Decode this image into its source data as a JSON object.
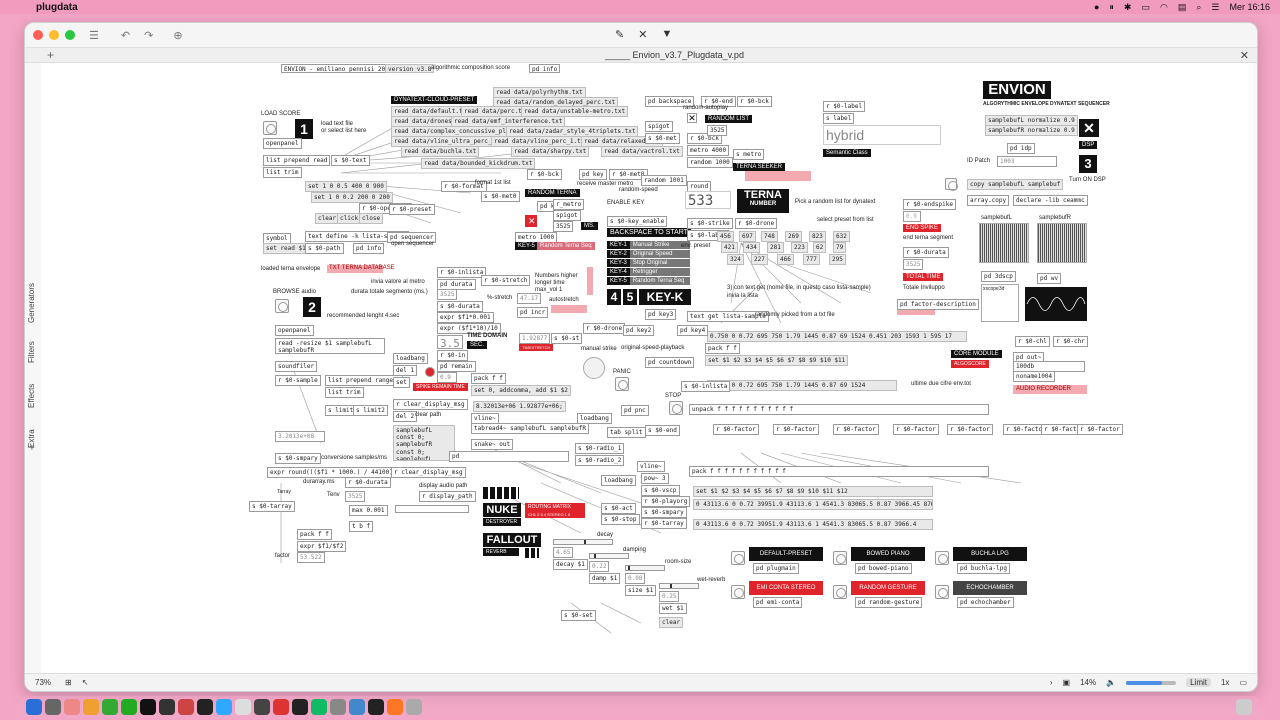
{
  "menubar": {
    "app": "plugdata",
    "clock": "Mer 16:16"
  },
  "window": {
    "tab_title": "_____ Envion_v3.7_Plugdata_v.pd",
    "side_tabs": [
      "Generators",
      "Filters",
      "Effects",
      "Extra"
    ],
    "side_plus": "+"
  },
  "patch": {
    "header": [
      "ENVION - emiliano pennisi 2025",
      "version v3.8",
      "algorithmic composition score",
      "pd info"
    ],
    "load_score": "LOAD SCORE",
    "load_text": "load text file",
    "or_select": "or select list here",
    "openpanel": "openpanel",
    "list_prepend_read": "list prepend read",
    "list_trim": "list trim",
    "num1": "1",
    "num2": "2",
    "num3": "3",
    "send_text": "s $0-text",
    "dynatext_preset": "DYNATEXT-CLOUD-PRESET",
    "read_files": [
      "read data/polyrhythm.txt",
      "read data/random_delayed_perc.txt",
      "read data/default.txt",
      "read data/perc.txt",
      "read data/unstable-metro.txt",
      "read data/drones.txt",
      "read data/emf_interference.txt",
      "read data/complex_concussive_plain.txt",
      "read data/zadar_style_4triplets.txt",
      "read data/vline_ultra_perc_3.txt",
      "read data/vline_perc_1.txt",
      "read data/relaxed.txt",
      "read data/buchla.txt",
      "read data/sharpy.txt",
      "read data/vactrol.txt",
      "read data/bounded_kickdrum.txt"
    ],
    "set_lists": [
      "set 1 0 0.5 400 0 900",
      "set 1 0 0.2 200 0 200"
    ],
    "clear": "clear",
    "click": "click",
    "close": "close",
    "r_openlist": "r $0-openlist",
    "r_preset": "r $0-preset",
    "symbol": "symbol",
    "set_read": "set read $1",
    "text_define": "text define -k lista-sample",
    "s_path": "s $0-path",
    "pd_info2": "pd info",
    "pd_sequencer": "pd sequencer",
    "open_sequencer": "open sequencer",
    "loaded_envelope": "loaded terna envelope",
    "txt_db": "TXT TERNA DATABASE",
    "format_1st": "format 1st list",
    "r_format": "r $0-format",
    "s_met0": "s $0-met0",
    "r_bck": "r $0-bck",
    "random_terna": "RANDOM TERNA",
    "receive_master": "receive master metro",
    "random_speed": "random-speed",
    "pd_key": "pd key",
    "r_met0": "r $0-met0",
    "r_metro": "r_metro",
    "spigot": "spigot",
    "metro1000": "metro 1000",
    "ms": "MS.",
    "key5": "KEY-5",
    "random_terna_seq": "Random Terna Seq",
    "enable_key": "ENABLE KEY",
    "s_key_enable": "s $0-key_enable",
    "backspace_start": "BACKSPACE TO START",
    "keys": [
      {
        "k": "KEY-1",
        "v": "Manual Strike"
      },
      {
        "k": "KEY-2",
        "v": "Original Speed"
      },
      {
        "k": "KEY-3",
        "v": "Stop Original"
      },
      {
        "k": "KEY-4",
        "v": "Retrigger"
      },
      {
        "k": "KEY-5",
        "v": "Random Terna Seq"
      }
    ],
    "key4": "4",
    "key5b": "5",
    "keyk": "KEY-K",
    "pd_backspace": "pd backspace",
    "r_end": "r $0-end",
    "r_bck2": "r $0-bck",
    "random_autoplay": "random-autoplay",
    "random_list": "RANDOM LIST",
    "s_met": "s $0-met",
    "r_bck3": "r $0-bck",
    "metro4000": "metro 4000",
    "random1000": "random 1000",
    "s_metro": "s metro",
    "terna_seeker": "TERNA SEEKER",
    "random_1001": "random 1001",
    "round": "round",
    "terna_value": "533",
    "terna": "TERNA",
    "terna_number": "NUMBER",
    "pick_random": "Pick a random list for dynatext",
    "s_strike": "s $0-strike",
    "r_drone": "r $0-drone",
    "select_preset": "select preset from list",
    "s_label": "s $0-label",
    "env_preset": "env. preset",
    "preset_nums": [
      "456",
      "697",
      "748",
      "269",
      "823",
      "632",
      "421",
      "434",
      "281",
      "223",
      "62",
      "79",
      "324",
      "227",
      "466",
      "777",
      "295"
    ],
    "get_text": "3) con text get (nome file, in questo caso lista-sample)",
    "invia_lista": "invia la lista",
    "get_list_sample": "text get lista-sample",
    "randomly_picked": "randomly picked from a txt file",
    "r_label": "r $0-label",
    "s_label2": "s label",
    "hybrid": "hybrid",
    "semantic_class": "Semantic Class",
    "envion_title": "ENVION",
    "envion_sub": "ALGORYTHMIC ENVELOPE DYNATEXT SEQUENCER",
    "normalize_l": "samplebufL normalize 0.9",
    "normalize_r": "samplebufR normalize 0.9",
    "dsp": "DSP",
    "turn_on_dsp": "Turn ON DSP",
    "pd_idp": "pd idp",
    "id_patch": "ID Patch",
    "id_patch_val": "1003",
    "copy_samplebuf": "copy samplebufL samplebuf",
    "array_copy": "array.copy",
    "declare": "declare -lib ceammc",
    "r_endspike": "r $0-endspike",
    "end_spike": "END SPIKE",
    "end_terna_segment": "end terna segment",
    "r_durata": "r $0-durata",
    "durata_val": "3525",
    "total_time": "TOTAL TIME",
    "totale_inviluppo": "Totale Inviluppo",
    "samplebufl": "samplebufL",
    "samplebufr": "samplebufR",
    "pd_3dscp": "pd 3dscp",
    "pd_wv": "pd wv",
    "xscope": "xscope3d",
    "pd_factor_desc": "pd factor-description",
    "core_module": "CORE MODULE",
    "algoscore": "ALGOSCORE",
    "r_chl": "r $0-chl",
    "r_chr": "r $0-chr",
    "pd_out": "pd out~",
    "val_100db": "100db",
    "noname": "noname1004",
    "audio_recorder": "AUDIO RECORDER",
    "ultime_due": "ultime due cifre env.tot",
    "long_list1": "0.750 0 0.72 695 750 1.79 1445 0.87 69 1524 0.451 203 1593 1 595 17",
    "set_s": "set $1 $2 $3 $4 $5 $6 $7 $8 $9 $10 $11",
    "long_list2": "0.750 0 0.72 695 750 1.79 1445 0.87 69 1524",
    "s_inlista": "s $0-inlista",
    "unpack": "unpack f f f f f f f f f f f",
    "r_factor": "r $0-factor",
    "pack_f": "pack f f f f f f f f f f f",
    "set_s2": "set $1 $2 $3 $4 $5 $6 $7 $8 $9 $10 $11 $12",
    "long_list3": "0 43113.6 0 0.72 39951.9 43113.6 1 4541.3 83065.5 0.87 3966.45 87608.8",
    "long_list4": "0 43113.6 0 0.72 39951.9 43113.6 1 4541.3 83065.5 0.87 3966.4",
    "browse_audio": "BROWSE audio",
    "recommended": "recommended lenght 4.sec",
    "read_resize": "read -resize $1 samplebufL samplebufR",
    "soundfiler": "soundfiler",
    "r_sample": "r $0-sample",
    "list_prepend_range": "list prepend range 0",
    "list_trim2": "list trim",
    "s_limit1": "s limit1",
    "s_limit2": "s limit2",
    "sample_val": "3.2013e+08",
    "s_smpary": "s $0-smpary",
    "conversione": "conversione samples/ms",
    "expr_round": "expr round((($f1 * 1000.) / 44100) * 100) / 100",
    "r_clear_display": "r clear_display_msg",
    "durarray": "durarray.ms",
    "r_durata2": "r $0-durata",
    "tarray": "Tarray",
    "tenv": "Tenv",
    "tenv_val": "3525",
    "max": "max 0.001",
    "display_audio": "display audio path",
    "r_display_path": "r display_path",
    "s_tarray": "s $0-tarray",
    "pack_ff": "pack f f",
    "expr_f1f2": "expr $f1/$f2",
    "factor": "factor",
    "factor_val": "53.522",
    "r_inlista": "r $0-inlista",
    "invia_valore": "invia valore al metro",
    "durata_totale": "durata totale segmento (ms.)",
    "r_stretch": "r $0-stretch",
    "numbers_higher": "Numbers higher",
    "longer_time": "longer time",
    "max_vol": "max_vol 1",
    "stretch_pct": "%-stretch",
    "stretch_val": "47.17",
    "autostretch": "autostretch",
    "s_durata": "s $0-durata",
    "expr_f1": "expr $f1*0.001",
    "r_durata3": "r $0-durata",
    "expr_f1_10": "expr ($f1*10)/10",
    "time_domain": "TIME DOMAIN",
    "sec": "SEC.",
    "sec_val": "3.5",
    "stretch_num": "1.92877",
    "pd_incr": "pd incr",
    "r_in": "r $0-in",
    "s_st": "s $0-st",
    "pd_remain": "pd remain",
    "spike_remain": "SPIKE REMAIN TIME",
    "set_addcomma": "set 0, addcomma, add $1 $2",
    "val_e06": "8.32013e+06 1.92877e+06;",
    "tabread4": "tabread4~ samplebufL samplebufR",
    "loadbang": "loadbang",
    "r_clear_display2": "r clear_display_msg",
    "clear_path": "clear path",
    "samplebuf_const": "samplebufL const 0; samplebufR const 0; samplebufL resize 1; samplebufR resize 1;",
    "del1": "del 1",
    "del2": "del 2",
    "snake_out": "snake~ out",
    "nuke": "NUKE",
    "destroyer": "DESTROYER",
    "routing": "ROUTING MATRIX",
    "ch": "CH1 2 3 4 STEREO 1 8",
    "fallout": "FALLOUT",
    "reverb": "REVERB",
    "r_drone2": "r $0-drone",
    "manual_strike": "manual strike",
    "pd_key2": "pd key2",
    "pd_key4": "pd key4",
    "pd_key3": "pd key3",
    "original_speed": "original-speed-playback",
    "pd_countdown": "pd countdown",
    "panic": "PANIC",
    "stop": "STOP",
    "pd_pnc": "pd pnc",
    "s_end": "s $0-end",
    "tabsplit": "tab split",
    "s_radio1": "s $0-radio_1",
    "s_radio2": "s $0-radio_2",
    "vline": "vline~",
    "pow3": "pow~ 3",
    "s_vscp": "s $0-vscp",
    "r_playorg": "r $0-playorg",
    "s_smpary2": "s $0-smpary",
    "r_tarray": "r $0-tarray",
    "s_act": "s $0-act",
    "s_stop": "s $0-stop",
    "decay": "decay",
    "damping": "damping",
    "room_size": "room-size",
    "wet_reverb": "wet-reverb",
    "decay_s": "decay $1",
    "damp_s": "damp $1",
    "size_s": "size $1",
    "wet_s": "wet $1",
    "val_465": "4.65",
    "val_022": "0.22",
    "val_008": "0.08",
    "val_025": "0.25",
    "clear2": "clear",
    "s_set": "s $0-set",
    "presets": [
      {
        "label": "DEFAULT-PRESET",
        "pd": "pd plugmain",
        "red": false
      },
      {
        "label": "BOWED PIANO",
        "pd": "pd bowed-piano",
        "red": false
      },
      {
        "label": "BUCHLA LPG",
        "pd": "pd buchla-lpg",
        "red": false
      },
      {
        "label": "EMI CONTA STEREO",
        "pd": "pd emi-conta",
        "red": true
      },
      {
        "label": "RANDOM GESTURE",
        "pd": "pd random-gesture",
        "red": true
      },
      {
        "label": "ECHOCHAMBER",
        "pd": "pd echochamber",
        "red": false
      }
    ]
  },
  "statusbar": {
    "zoom": "73%",
    "cpu": "14%",
    "limit": "Limit",
    "x": "1x"
  },
  "colors": {
    "accent_red": "#e0242c",
    "pink": "#f3a9b0",
    "black": "#111111"
  }
}
